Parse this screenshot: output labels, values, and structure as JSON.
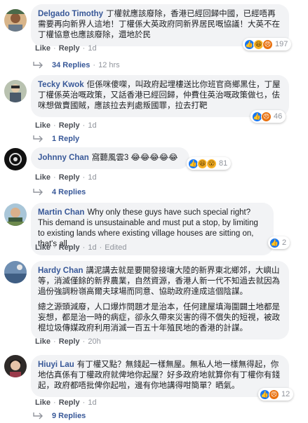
{
  "comments": [
    {
      "name": "Delgado Timothy",
      "text": "丁權就應該廢除，香港已經回歸中國，已經唔再需要再向新界人這地！丁權係大英政府同新界居民嘅協議！大英不在丁權協意也應該廢除，還地於民",
      "actions": {
        "like": "Like",
        "reply": "Reply",
        "time": "1d"
      },
      "reactions": {
        "icons": [
          "like-icon",
          "haha-icon",
          "angry-icon"
        ],
        "count": "197"
      },
      "replies": {
        "label": "34 Replies",
        "time": "12 hrs"
      }
    },
    {
      "name": "Tecky Kwok",
      "text": "佢係咪傻㗎，叫政府起埋樓送比你班官商鄉黑住，丁屋丁權係英治嘅政策，又話香港已經回歸，仲費住英治嘅政策做乜，佉咪想做賣國賊，應該拉去判處叛國罪，拉去打靶",
      "actions": {
        "like": "Like",
        "reply": "Reply",
        "time": "1d"
      },
      "reactions": {
        "icons": [
          "like-icon",
          "angry-icon"
        ],
        "count": "46"
      },
      "replies": {
        "label": "1 Reply",
        "time": ""
      }
    },
    {
      "name": "Johnny Chan",
      "text": "窩聽風雲3 😂😂😂😂😂",
      "actions": {
        "like": "Like",
        "reply": "Reply",
        "time": "1d"
      },
      "reactions": {
        "icons": [
          "like-icon",
          "haha-icon",
          "wow-icon"
        ],
        "count": "81"
      },
      "replies": {
        "label": "4 Replies",
        "time": ""
      }
    },
    {
      "name": "Martin Chan",
      "text": "Why only these guys have such special right? This demand is unsustainable and must put a stop, by limiting to existing lands where existing village houses are sitting on, that's all.",
      "actions": {
        "like": "Like",
        "reply": "Reply",
        "time": "1d",
        "edited": "Edited"
      },
      "reactions": {
        "icons": [
          "like-icon"
        ],
        "count": "2"
      }
    },
    {
      "name": "Hardy Chan",
      "paragraphs": [
        "講泥講去就是要開發接壤大陸的新界東北鄉郊，大嶼山等，消滅僅餘的新界農業，自然資源，香港人新一代不知過去就因為過份強調粉嶺高爾夫球場而同意、協助政府達成這個陰謀。",
        "總之源頭減廢，人口爆炸問題才是治本，任何建屋填海圍闢土地都是妄想，都是治一時的病症，卻永久帶來災害的得不償失的短視，被政棍垃圾傳媒政府利用消滅一百五十年殖民地的香港的計謀。"
      ],
      "actions": {
        "like": "Like",
        "reply": "Reply",
        "time": "20h"
      }
    },
    {
      "name": "Hiuyi Lau",
      "text": "有丁權又點？無錢起一樣無屋。無私人地一樣無得起，你地估真係有丁權政府就俾地你起屋？好多政府地就算你有丁權你有錢起，政府都唔批俾你起啦，邊有你地講得咁簡單？晒氣。",
      "actions": {
        "like": "Like",
        "reply": "Reply",
        "time": "1d"
      },
      "reactions": {
        "icons": [
          "like-icon",
          "angry-icon"
        ],
        "count": "12"
      },
      "replies": {
        "label": "9 Replies",
        "time": ""
      }
    }
  ],
  "colors": {
    "name": "#385898",
    "bubble": "#f2f3f5",
    "meta": "#90949c",
    "like": "#1877f2",
    "haha": "#f7b125",
    "angry": "#e9710f"
  }
}
